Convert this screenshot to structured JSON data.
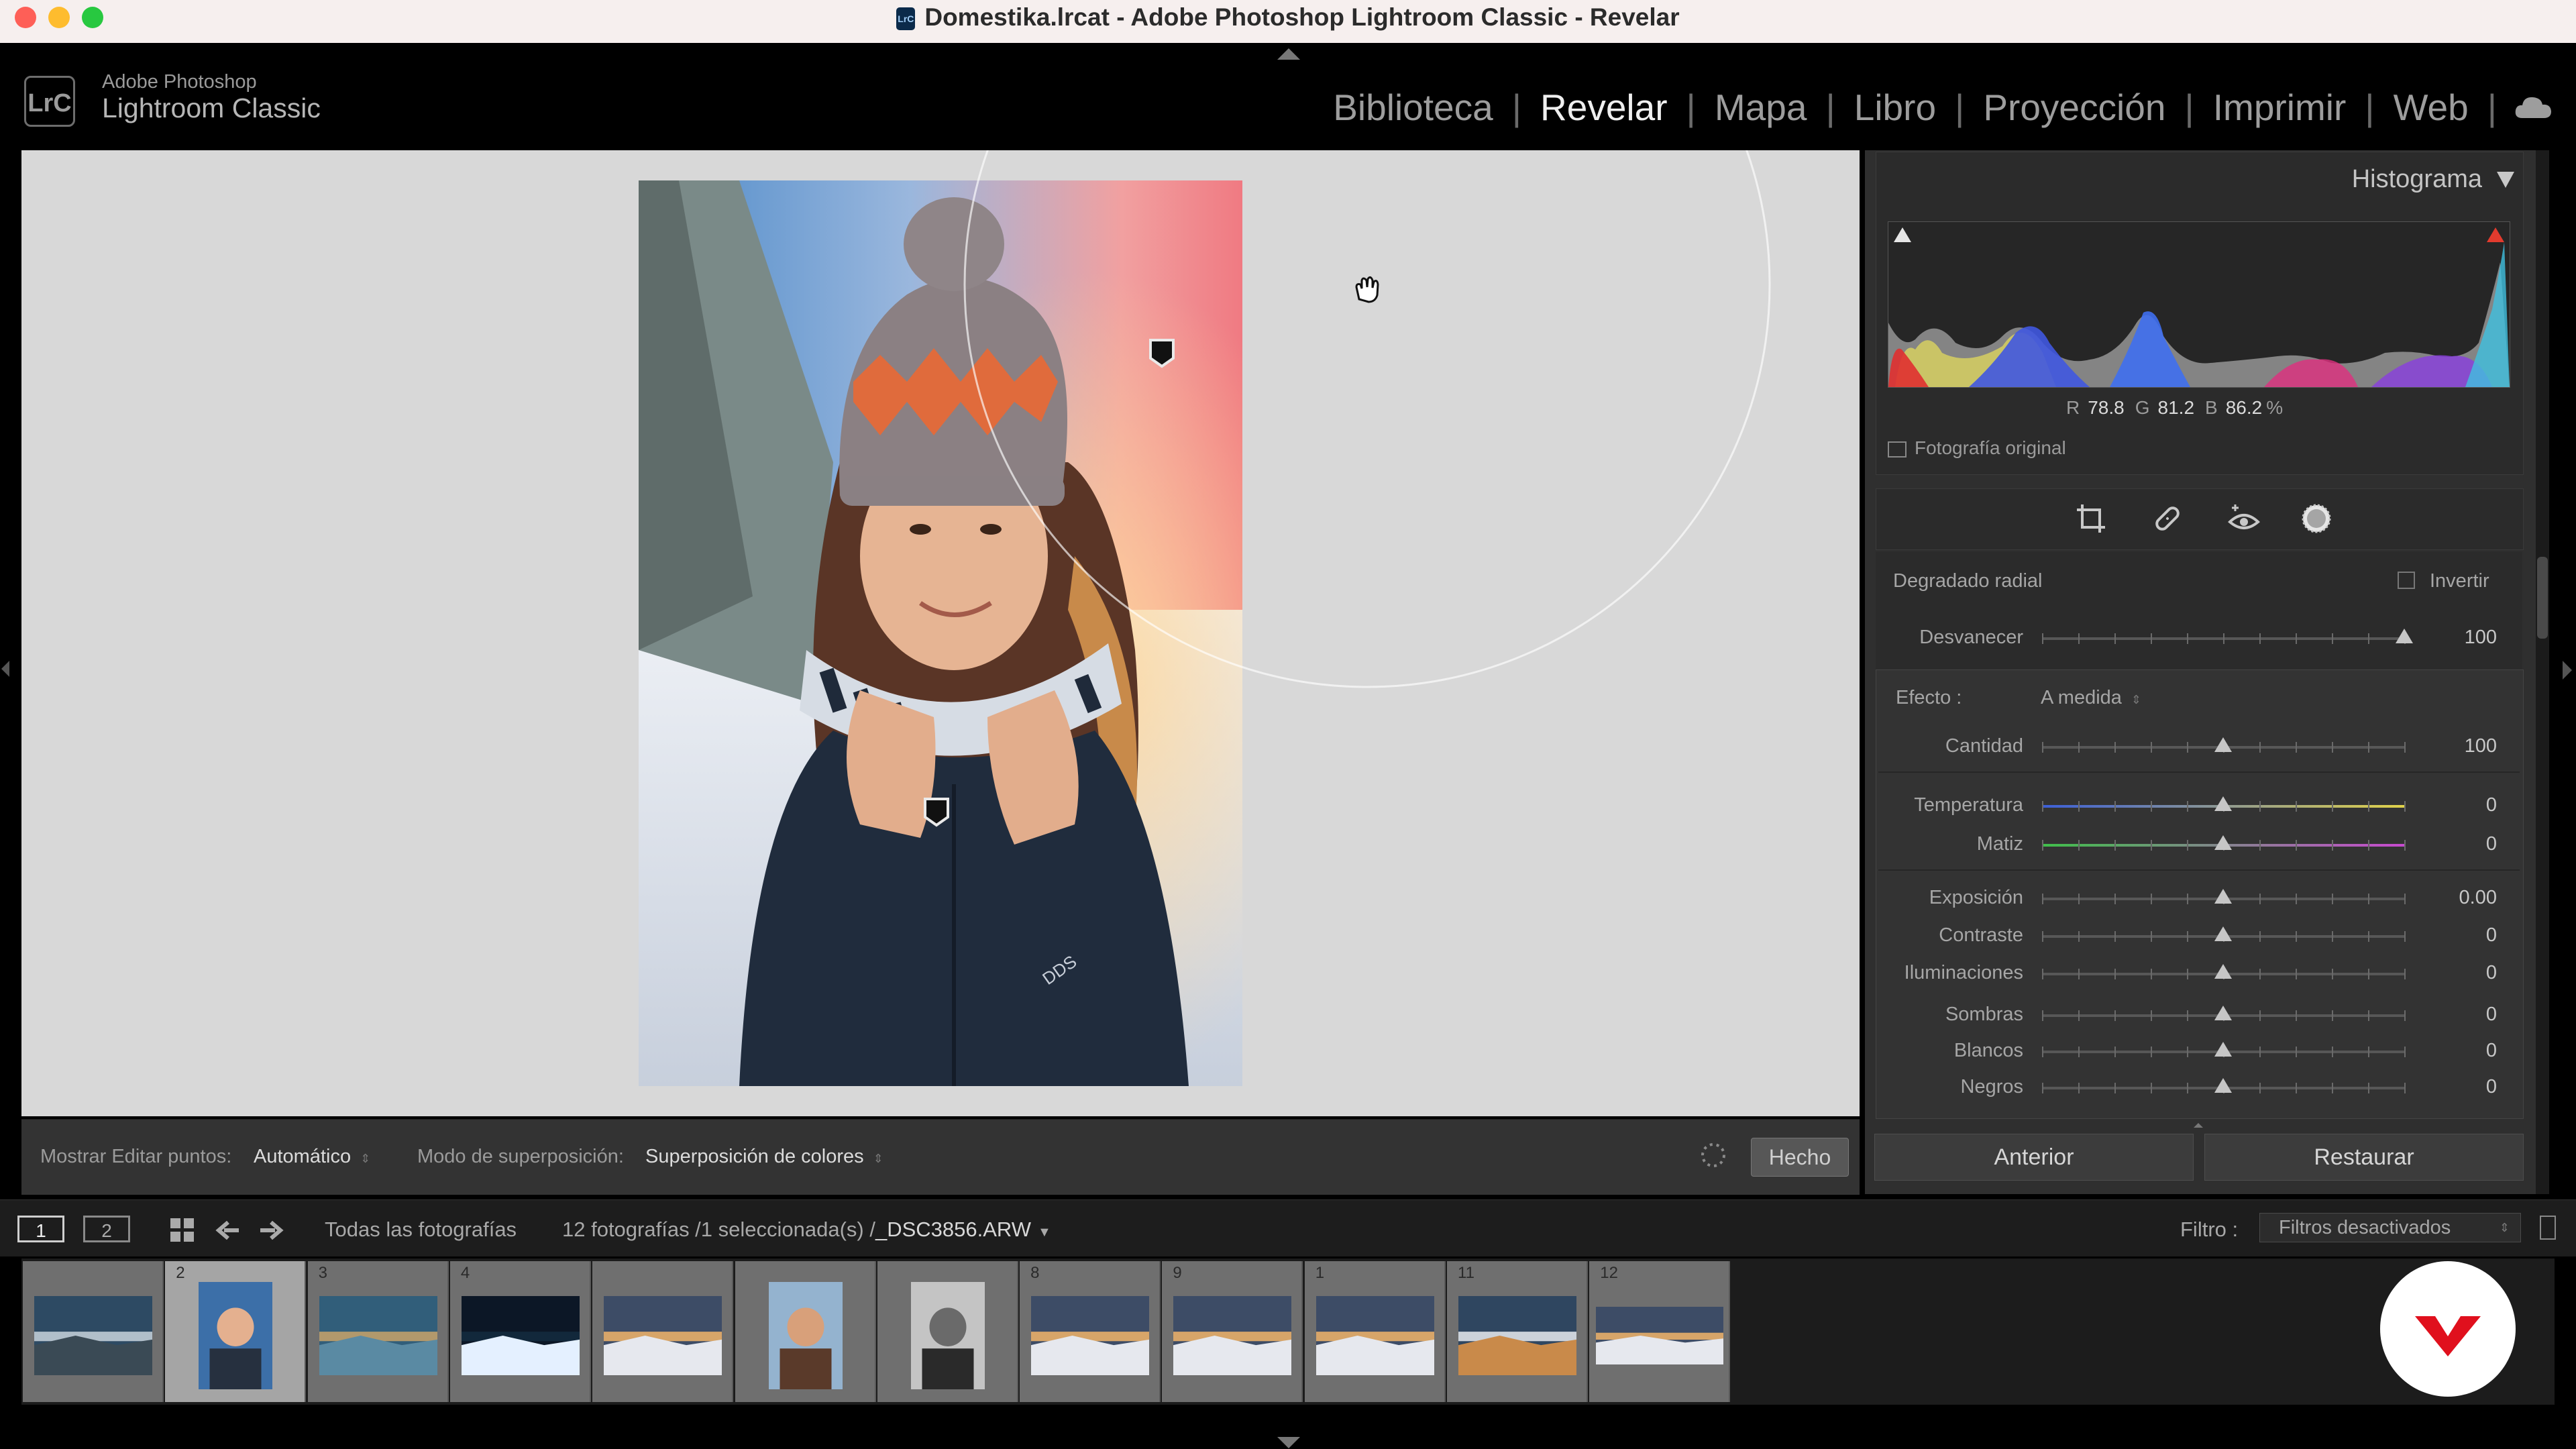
{
  "window": {
    "title": "Domestika.lrcat - Adobe Photoshop Lightroom Classic - Revelar",
    "icon_label": "LrC"
  },
  "brand": {
    "logo_text": "LrC",
    "line1": "Adobe Photoshop",
    "line2": "Lightroom Classic"
  },
  "modules": [
    {
      "label": "Biblioteca"
    },
    {
      "label": "Revelar",
      "active": true
    },
    {
      "label": "Mapa"
    },
    {
      "label": "Libro"
    },
    {
      "label": "Proyección"
    },
    {
      "label": "Imprimir"
    },
    {
      "label": "Web"
    }
  ],
  "toolbar": {
    "show_edit_pins_label": "Mostrar Editar puntos:",
    "show_edit_pins_value": "Automático",
    "overlay_mode_label": "Modo de superposición:",
    "overlay_mode_value": "Superposición de colores",
    "done_label": "Hecho"
  },
  "histogram": {
    "title": "Histograma",
    "r_label": "R",
    "r_value": "78.8",
    "g_label": "G",
    "g_value": "81.2",
    "b_label": "B",
    "b_value": "86.2",
    "unit": "%",
    "original_label": "Fotografía original"
  },
  "tools": [
    "crop-icon",
    "healing-icon",
    "red-eye-icon",
    "masking-icon"
  ],
  "mask": {
    "title": "Degradado radial",
    "invert_label": "Invertir",
    "feather_label": "Desvanecer",
    "feather_value": "100",
    "feather_level": 1.0
  },
  "effect": {
    "label": "Efecto :",
    "preset": "A medida",
    "sliders": [
      {
        "label": "Cantidad",
        "value": "100",
        "level": 0.5,
        "track": "#575757"
      },
      {
        "label": "Temperatura",
        "value": "0",
        "level": 0.5,
        "track": "gradient-temp"
      },
      {
        "label": "Matiz",
        "value": "0",
        "level": 0.5,
        "track": "gradient-tint"
      },
      {
        "label": "Exposición",
        "value": "0.00",
        "level": 0.5,
        "track": "#575757"
      },
      {
        "label": "Contraste",
        "value": "0",
        "level": 0.5,
        "track": "#575757"
      },
      {
        "label": "Iluminaciones",
        "value": "0",
        "level": 0.5,
        "track": "#575757"
      },
      {
        "label": "Sombras",
        "value": "0",
        "level": 0.5,
        "track": "#575757"
      },
      {
        "label": "Blancos",
        "value": "0",
        "level": 0.5,
        "track": "#575757"
      },
      {
        "label": "Negros",
        "value": "0",
        "level": 0.5,
        "track": "#575757"
      }
    ]
  },
  "buttons": {
    "previous": "Anterior",
    "reset": "Restaurar"
  },
  "filmstrip_bar": {
    "view1": "1",
    "view2": "2",
    "source": "Todas las fotografías",
    "count": "12 fotografías /1 seleccionada(s) /",
    "filename": "_DSC3856.ARW",
    "filter_label": "Filtro :",
    "filter_value": "Filtros desactivados"
  },
  "filmstrip": [
    {
      "num": "",
      "kind": "mountain-lake"
    },
    {
      "num": "2",
      "kind": "portrait",
      "selected": true
    },
    {
      "num": "3",
      "kind": "lake"
    },
    {
      "num": "4",
      "kind": "night-tent"
    },
    {
      "num": "",
      "kind": "sunset-snow"
    },
    {
      "num": "",
      "kind": "portrait-warm"
    },
    {
      "num": "",
      "kind": "portrait-bw"
    },
    {
      "num": "8",
      "kind": "sunset-snow"
    },
    {
      "num": "9",
      "kind": "sunset-snow"
    },
    {
      "num": "1",
      "kind": "sunset-snow"
    },
    {
      "num": "11",
      "kind": "mountain-snow"
    },
    {
      "num": "12",
      "kind": "sunset-snow-wide"
    }
  ],
  "colors": {
    "accent": "#efefef",
    "panel": "#2f2f2f",
    "canvas": "#d8d8d8",
    "domestika_red": "#e0101d"
  }
}
